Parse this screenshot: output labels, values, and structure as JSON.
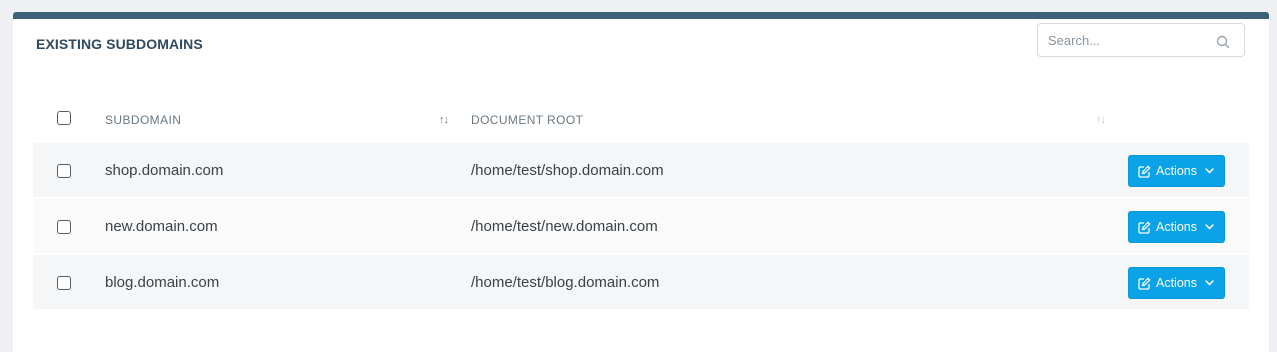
{
  "panel": {
    "title": "EXISTING SUBDOMAINS",
    "accent_color": "#3d6178"
  },
  "search": {
    "placeholder": "Search...",
    "icon": "search-icon"
  },
  "table": {
    "columns": {
      "subdomain": "SUBDOMAIN",
      "document_root": "DOCUMENT ROOT"
    },
    "sort_icon_glyph": "↑↓",
    "rows": [
      {
        "subdomain": "shop.domain.com",
        "document_root": "/home/test/shop.domain.com",
        "action_label": "Actions"
      },
      {
        "subdomain": "new.domain.com",
        "document_root": "/home/test/new.domain.com",
        "action_label": "Actions"
      },
      {
        "subdomain": "blog.domain.com",
        "document_root": "/home/test/blog.domain.com",
        "action_label": "Actions"
      }
    ],
    "action_button_color": "#0aa3e8"
  }
}
